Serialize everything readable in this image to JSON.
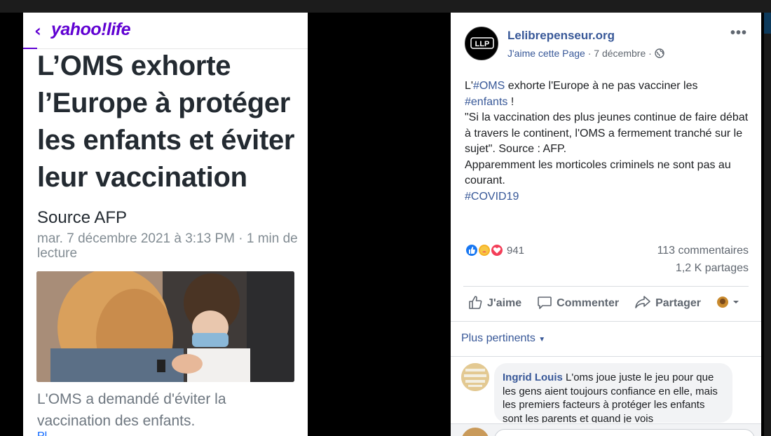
{
  "yahoo": {
    "logo": "yahoo!life",
    "headline": "L’OMS exhorte l’Europe à protéger les enfants et éviter leur vaccination",
    "source": "Source AFP",
    "date": "mar. 7 décembre 2021 à 3:13 PM · 1 min de lecture",
    "caption": "L'OMS a demandé d'éviter la vaccination des enfants.",
    "more": "Pl"
  },
  "facebook": {
    "page_name": "Lelibrepenseur.org",
    "like_page": "J'aime cette Page",
    "post_date": "· 7 décembre ·",
    "post_lines": {
      "l1a": "L'",
      "l1tag": "#OMS",
      "l1b": " exhorte l'Europe à ne pas vacciner les",
      "l2tag": "#enfants",
      "l2b": " !",
      "l3": "\"Si la vaccination des plus jeunes continue de faire débat à travers le continent, l'OMS a fermement tranché sur le sujet\". Source : AFP.",
      "l4": "Apparemment les morticoles criminels ne sont pas au courant.",
      "l5tag": "#COVID19"
    },
    "reactions_count": "941",
    "comments": "113 commentaires",
    "shares": "1,2 K partages",
    "actions": {
      "like": "J'aime",
      "comment": "Commenter",
      "share": "Partager"
    },
    "sort_label": "Plus pertinents",
    "comment": {
      "author": "Ingrid Louis",
      "text": " L'oms joue juste le jeu pour que les gens aient toujours confiance en elle, mais les premiers facteurs à protéger les enfants sont les parents et quand je vois"
    }
  },
  "colors": {
    "yahoo_purple": "#6001d2",
    "fb_blue": "#385898",
    "like_blue": "#1877f2",
    "love_red": "#f33e58"
  }
}
